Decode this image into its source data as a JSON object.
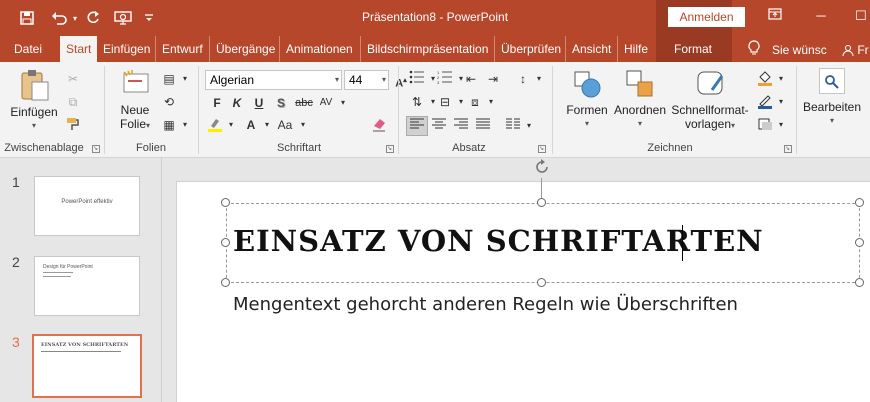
{
  "window": {
    "title": "Präsentation8 - PowerPoint",
    "signin_label": "Anmelden",
    "minimize": "─",
    "restore": "☐",
    "ribbon_options": "⧉"
  },
  "qat": {
    "save_icon": "💾",
    "undo_icon": "↶",
    "redo_icon": "↻",
    "present_icon": "⊙",
    "customize_icon": "⌄"
  },
  "tabs": [
    {
      "label": "Datei"
    },
    {
      "label": "Start"
    },
    {
      "label": "Einfügen"
    },
    {
      "label": "Entwurf"
    },
    {
      "label": "Übergänge"
    },
    {
      "label": "Animationen"
    },
    {
      "label": "Bildschirmpräsentation"
    },
    {
      "label": "Überprüfen"
    },
    {
      "label": "Ansicht"
    },
    {
      "label": "Hilfe"
    },
    {
      "label": "Format"
    }
  ],
  "tell_me": "Sie wünsc",
  "share_partial": "Fr",
  "groups": {
    "clipboard": {
      "label": "Zwischenablage",
      "paste": "Einfügen"
    },
    "slides": {
      "label": "Folien",
      "new_slide_1": "Neue",
      "new_slide_2": "Folie"
    },
    "font": {
      "label": "Schriftart",
      "font_name": "Algerian",
      "font_size": "44"
    },
    "paragraph": {
      "label": "Absatz"
    },
    "drawing": {
      "label": "Zeichnen",
      "shapes": "Formen",
      "arrange": "Anordnen",
      "quick_styles_1": "Schnellformat-",
      "quick_styles_2": "vorlagen"
    },
    "editing": {
      "label": "Bearbeiten"
    }
  },
  "font_buttons": {
    "bold": "F",
    "italic": "K",
    "underline": "U",
    "shadow": "S",
    "strike": "abc",
    "spacing": "AV",
    "case": "Aa",
    "clear": "A"
  },
  "thumbnails": [
    {
      "num": "1",
      "text": "PowerPoint effektiv"
    },
    {
      "num": "2",
      "text": "Design für PowerPoint"
    },
    {
      "num": "3",
      "text": "Einsatz von Schriftarten"
    }
  ],
  "slide": {
    "title": "Einsatz von Schriftarten",
    "body": "Mengentext gehorcht anderen Regeln wie Überschriften"
  },
  "colors": {
    "accent": "#b7472a",
    "selection": "#e07050"
  }
}
